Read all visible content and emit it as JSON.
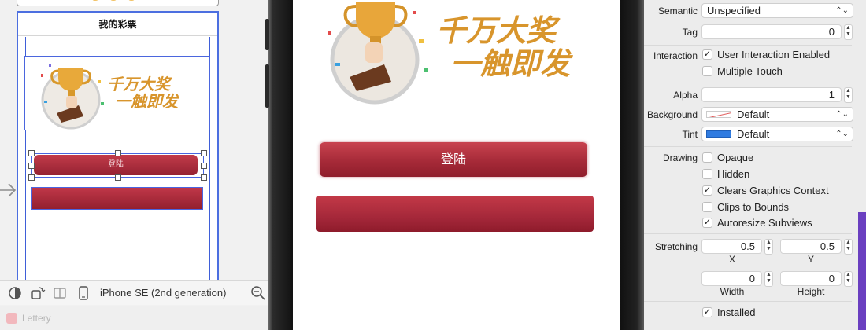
{
  "storyboard": {
    "scene_title": "我的彩票",
    "sb_login_label": "登陆",
    "device_name": "iPhone SE (2nd generation)",
    "project_label": "Lettery"
  },
  "simulator": {
    "login_label": "登陆",
    "banner_text_line1": "千万大奖",
    "banner_text_line2": "一触即发"
  },
  "inspector": {
    "semantic": {
      "label": "Semantic",
      "value": "Unspecified"
    },
    "tag": {
      "label": "Tag",
      "value": "0"
    },
    "interaction": {
      "label": "Interaction",
      "user_interaction": {
        "label": "User Interaction Enabled",
        "checked": true
      },
      "multiple_touch": {
        "label": "Multiple Touch",
        "checked": false
      }
    },
    "alpha": {
      "label": "Alpha",
      "value": "1"
    },
    "background": {
      "label": "Background",
      "value": "Default"
    },
    "tint": {
      "label": "Tint",
      "value": "Default",
      "color": "#2f7be0"
    },
    "drawing": {
      "label": "Drawing",
      "opaque": {
        "label": "Opaque",
        "checked": false
      },
      "hidden": {
        "label": "Hidden",
        "checked": false
      },
      "clears": {
        "label": "Clears Graphics Context",
        "checked": true
      },
      "clips": {
        "label": "Clips to Bounds",
        "checked": false
      },
      "autoresize": {
        "label": "Autoresize Subviews",
        "checked": true
      }
    },
    "stretching": {
      "label": "Stretching",
      "x": {
        "value": "0.5",
        "label": "X"
      },
      "y": {
        "value": "0.5",
        "label": "Y"
      },
      "width": {
        "value": "0",
        "label": "Width"
      },
      "height": {
        "value": "0",
        "label": "Height"
      }
    },
    "installed": {
      "label": "Installed",
      "checked": true
    }
  },
  "colors": {
    "button_red": "#a62a38",
    "selection_blue": "#4c6fe0",
    "tint_blue": "#2f7be0"
  }
}
